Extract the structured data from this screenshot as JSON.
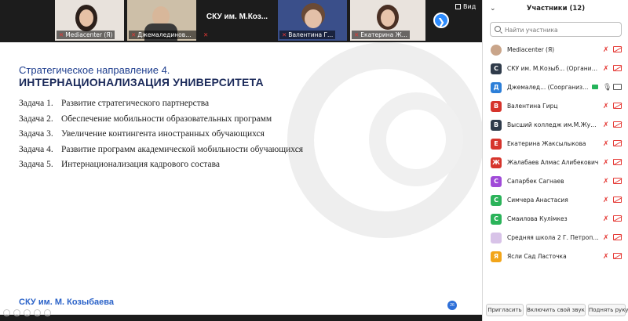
{
  "strip": {
    "tiles": [
      {
        "name": "Mediacenter (Я)"
      },
      {
        "name": "Джемалединовы..."
      },
      {
        "title": "СКУ им. М.Коз..."
      },
      {
        "name": "Валентина Г..."
      },
      {
        "name": "Екатерина Ж..."
      }
    ],
    "view_label": "Вид",
    "next_glyph": "❯"
  },
  "slide": {
    "heading_line1": "Стратегическое направление 4.",
    "heading_line2": "ИНТЕРНАЦИОНАЛИЗАЦИЯ УНИВЕРСИТЕТА",
    "tasks": [
      {
        "num": "Задача 1.",
        "text": "Развитие стратегического партнерства"
      },
      {
        "num": "Задача 2.",
        "text": "Обеспечение мобильности образовательных программ"
      },
      {
        "num": "Задача 3.",
        "text": "Увеличение контингента иностранных обучающихся"
      },
      {
        "num": "Задача 4.",
        "text": "Развитие программ академической мобильности обучающихся"
      },
      {
        "num": "Задача 5.",
        "text": "Интернационализация кадрового состава"
      }
    ],
    "footer": "СКУ им. М. Козыбаева",
    "page_number": "26"
  },
  "panel": {
    "title": "Участники (12)",
    "search_placeholder": "Найти участника",
    "participants": [
      {
        "letter": "",
        "color": "#c9a58a",
        "name": "Mediacenter (Я)"
      },
      {
        "letter": "С",
        "color": "#2f3b4a",
        "name": "СКУ им. М.Козыб... (Организатор)"
      },
      {
        "letter": "Д",
        "color": "#2d7fd8",
        "name": "Джемалед... (Соорганизатор)"
      },
      {
        "letter": "В",
        "color": "#d6342c",
        "name": "Валентина Гирц"
      },
      {
        "letter": "В",
        "color": "#2f3b4a",
        "name": "Высший колледж им.М.Жумаба..."
      },
      {
        "letter": "Е",
        "color": "#d6342c",
        "name": "Екатерина Жаксылыкова"
      },
      {
        "letter": "Ж",
        "color": "#d6342c",
        "name": "Жалабаев Алмас Алибекович"
      },
      {
        "letter": "С",
        "color": "#a04bd8",
        "name": "Сапарбек Сагнаев"
      },
      {
        "letter": "С",
        "color": "#2bb35a",
        "name": "Симчера Анастасия"
      },
      {
        "letter": "С",
        "color": "#2bb35a",
        "name": "Смаилова Кулімкез"
      },
      {
        "letter": "",
        "color": "#d8c3e8",
        "name": "Средняя школа 2 Г. Петропавл..."
      },
      {
        "letter": "Я",
        "color": "#f2a51a",
        "name": "Ясли Сад Ласточка"
      }
    ],
    "buttons": {
      "invite": "Пригласить",
      "unmute": "Включить свой звук",
      "raise_hand": "Поднять руку"
    }
  }
}
